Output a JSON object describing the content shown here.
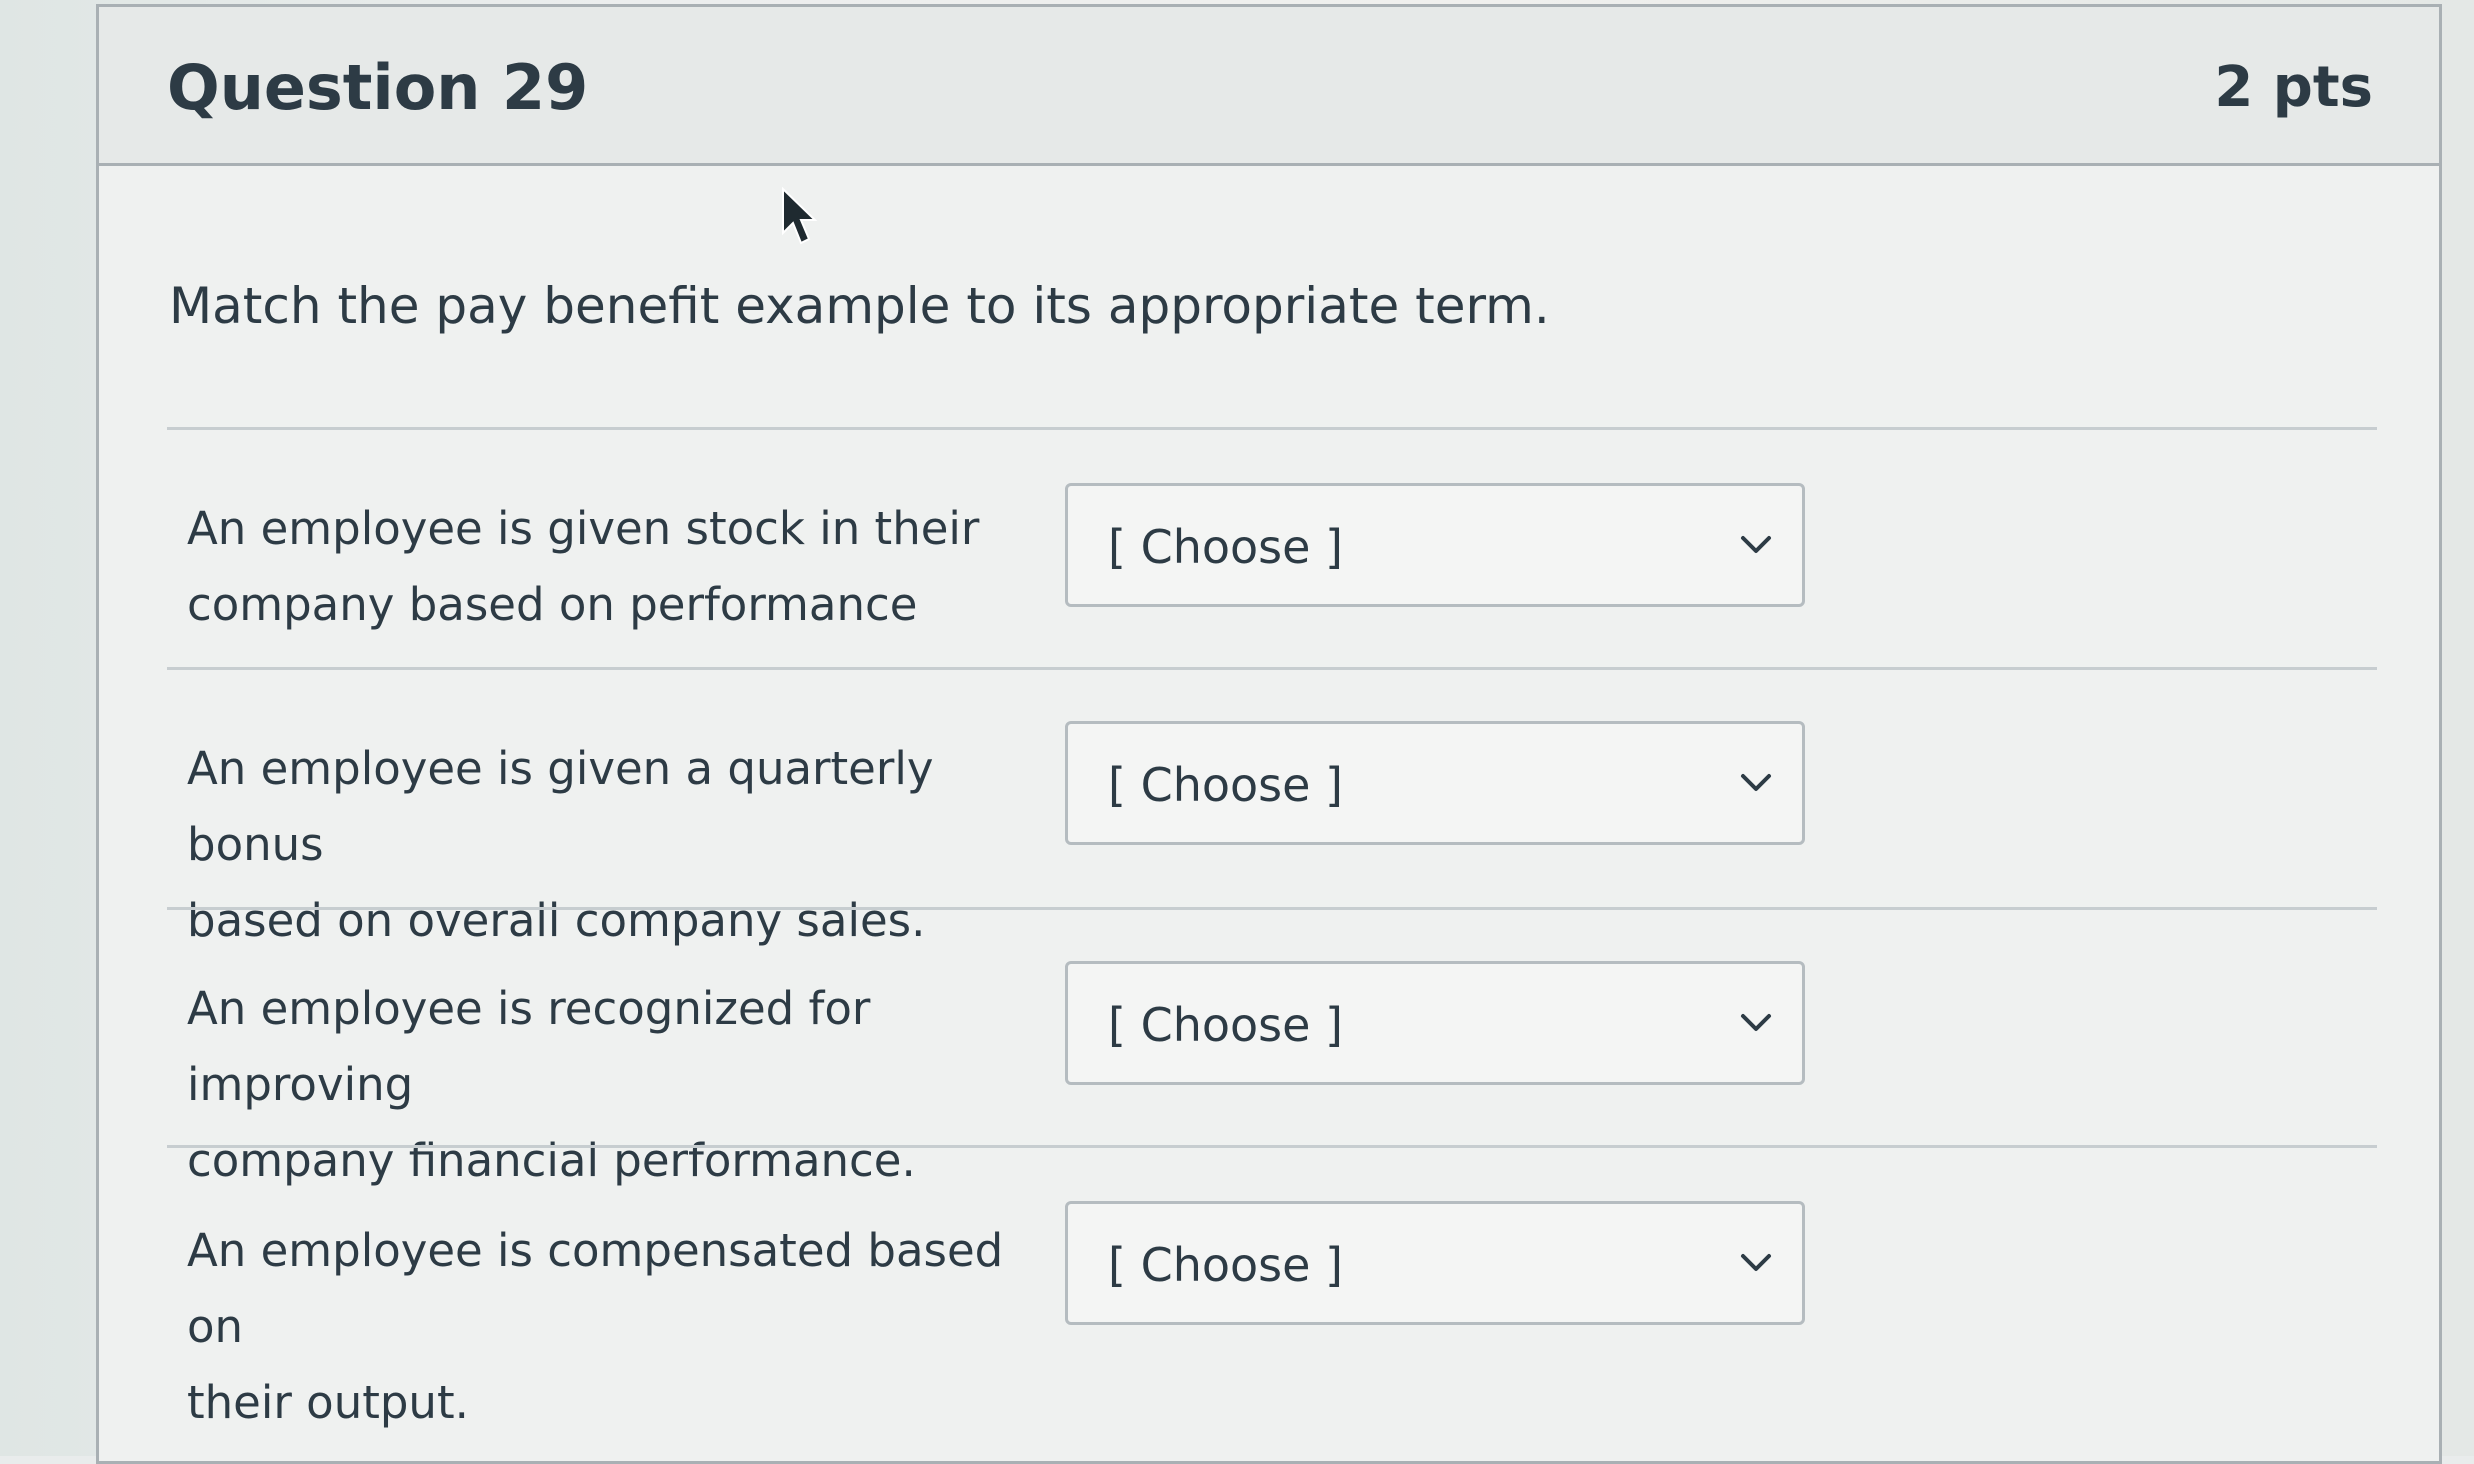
{
  "question": {
    "title": "Question 29",
    "points": "2 pts",
    "text": "Match the pay benefit example to its appropriate term."
  },
  "matches": [
    {
      "prompt_line1": "An employee is given stock in their",
      "prompt_line2": "company based on performance",
      "selected": "[ Choose ]"
    },
    {
      "prompt_line1": "An employee is given a quarterly bonus",
      "prompt_line2": "based on overall company sales.",
      "selected": "[ Choose ]"
    },
    {
      "prompt_line1": "An employee is recognized for improving",
      "prompt_line2": "company financial performance.",
      "selected": "[ Choose ]"
    },
    {
      "prompt_line1": "An employee is compensated based on",
      "prompt_line2": "their output.",
      "selected": "[ Choose ]"
    }
  ],
  "icons": {
    "cursor": "mouse-pointer-icon",
    "dropdown": "chevron-down-icon"
  },
  "colors": {
    "text": "#2d3b45",
    "border": "#a9b0b4",
    "divider": "#c7cdd0"
  }
}
